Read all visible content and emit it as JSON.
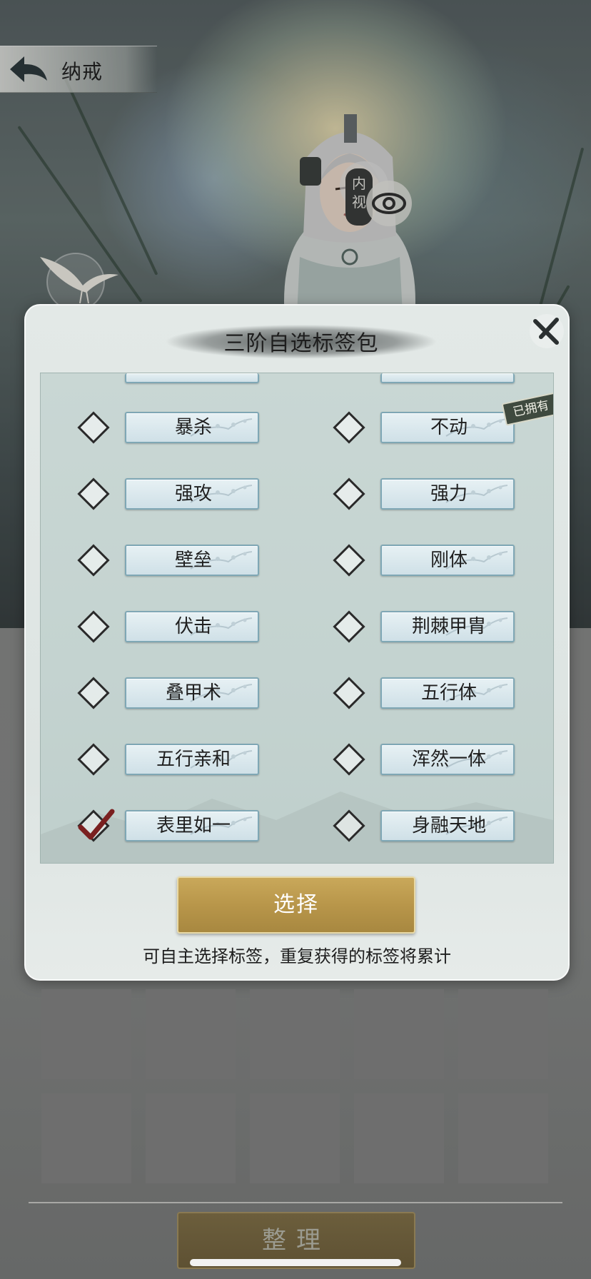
{
  "header": {
    "title": "纳戒"
  },
  "scene": {
    "inner_view_label": "内视"
  },
  "modal": {
    "title": "三阶自选标签包",
    "select_label": "选择",
    "hint": "可自主选择标签，重复获得的标签将累计",
    "owned_badge": "已拥有",
    "tags_left": [
      "暴杀",
      "强攻",
      "壁垒",
      "伏击",
      "叠甲术",
      "五行亲和",
      "表里如一"
    ],
    "tags_right": [
      "不动",
      "强力",
      "刚体",
      "荆棘甲胄",
      "五行体",
      "浑然一体",
      "身融天地"
    ],
    "checked": {
      "left_index": 6
    }
  },
  "bottom": {
    "sort_label": "整理"
  },
  "colors": {
    "gold_button": "#b8964a",
    "tag_border": "#7fa7b5",
    "panel_bg": "#c9d7d4",
    "slot_bg": "#6e6e6e"
  }
}
